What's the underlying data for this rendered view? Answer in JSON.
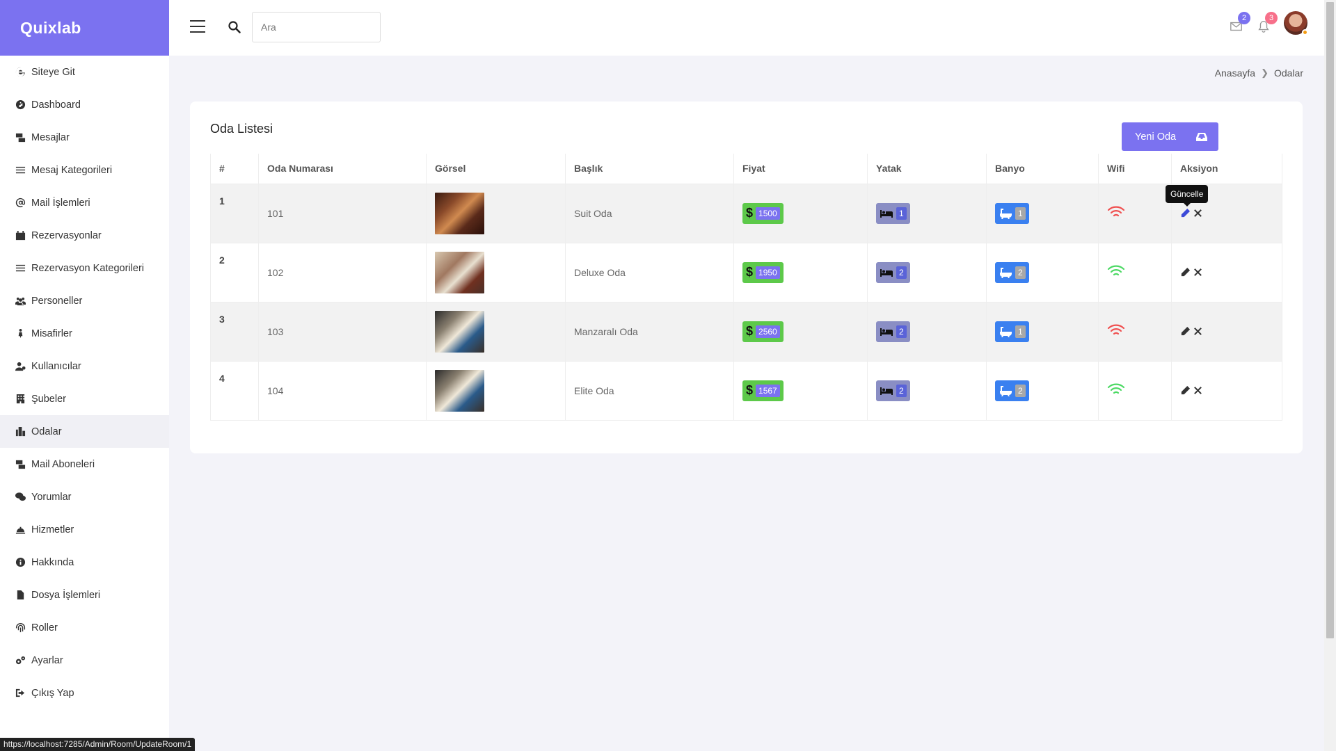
{
  "brand": "Quixlab",
  "sidebar": {
    "items": [
      {
        "label": "Siteye Git",
        "icon": "ie-icon"
      },
      {
        "label": "Dashboard",
        "icon": "dashboard-icon"
      },
      {
        "label": "Mesajlar",
        "icon": "messages-icon"
      },
      {
        "label": "Mesaj Kategorileri",
        "icon": "list-icon"
      },
      {
        "label": "Mail İşlemleri",
        "icon": "at-icon"
      },
      {
        "label": "Rezervasyonlar",
        "icon": "calendar-check-icon"
      },
      {
        "label": "Rezervasyon Kategorileri",
        "icon": "list-icon"
      },
      {
        "label": "Personeller",
        "icon": "users-icon"
      },
      {
        "label": "Misafirler",
        "icon": "guest-icon"
      },
      {
        "label": "Kullanıcılar",
        "icon": "user-gear-icon"
      },
      {
        "label": "Şubeler",
        "icon": "building-icon"
      },
      {
        "label": "Odalar",
        "icon": "rooms-icon"
      },
      {
        "label": "Mail Aboneleri",
        "icon": "mail-users-icon"
      },
      {
        "label": "Yorumlar",
        "icon": "comments-icon"
      },
      {
        "label": "Hizmetler",
        "icon": "service-bell-icon"
      },
      {
        "label": "Hakkında",
        "icon": "info-icon"
      },
      {
        "label": "Dosya İşlemleri",
        "icon": "file-icon"
      },
      {
        "label": "Roller",
        "icon": "fingerprint-icon"
      },
      {
        "label": "Ayarlar",
        "icon": "gears-icon"
      },
      {
        "label": "Çıkış Yap",
        "icon": "logout-icon"
      }
    ],
    "active": "Odalar"
  },
  "header": {
    "search_placeholder": "Ara",
    "mail_badge": "2",
    "notification_badge": "3"
  },
  "breadcrumb": {
    "home": "Anasayfa",
    "current": "Odalar"
  },
  "card": {
    "title": "Oda Listesi",
    "new_button": "Yeni Oda"
  },
  "table": {
    "headers": [
      "#",
      "Oda Numarası",
      "Görsel",
      "Başlık",
      "Fiyat",
      "Yatak",
      "Banyo",
      "Wifi",
      "Aksiyon"
    ],
    "rows": [
      {
        "index": "1",
        "room_no": "101",
        "title": "Suit Oda",
        "price": "1500",
        "beds": "1",
        "baths": "1",
        "wifi": false
      },
      {
        "index": "2",
        "room_no": "102",
        "title": "Deluxe Oda",
        "price": "1950",
        "beds": "2",
        "baths": "2",
        "wifi": true
      },
      {
        "index": "3",
        "room_no": "103",
        "title": "Manzaralı Oda",
        "price": "2560",
        "beds": "2",
        "baths": "1",
        "wifi": false
      },
      {
        "index": "4",
        "room_no": "104",
        "title": "Elite Oda",
        "price": "1567",
        "beds": "2",
        "baths": "2",
        "wifi": true
      }
    ]
  },
  "tooltip": "Güncelle",
  "status_url": "https://localhost:7285/Admin/Room/UpdateRoom/1",
  "colors": {
    "accent": "#7b72f0",
    "price_green": "#5dc94a",
    "bed_gray": "#8a8ec4",
    "bath_blue": "#3a80f0",
    "wifi_on": "#4cd964",
    "wifi_off": "#f05050"
  }
}
